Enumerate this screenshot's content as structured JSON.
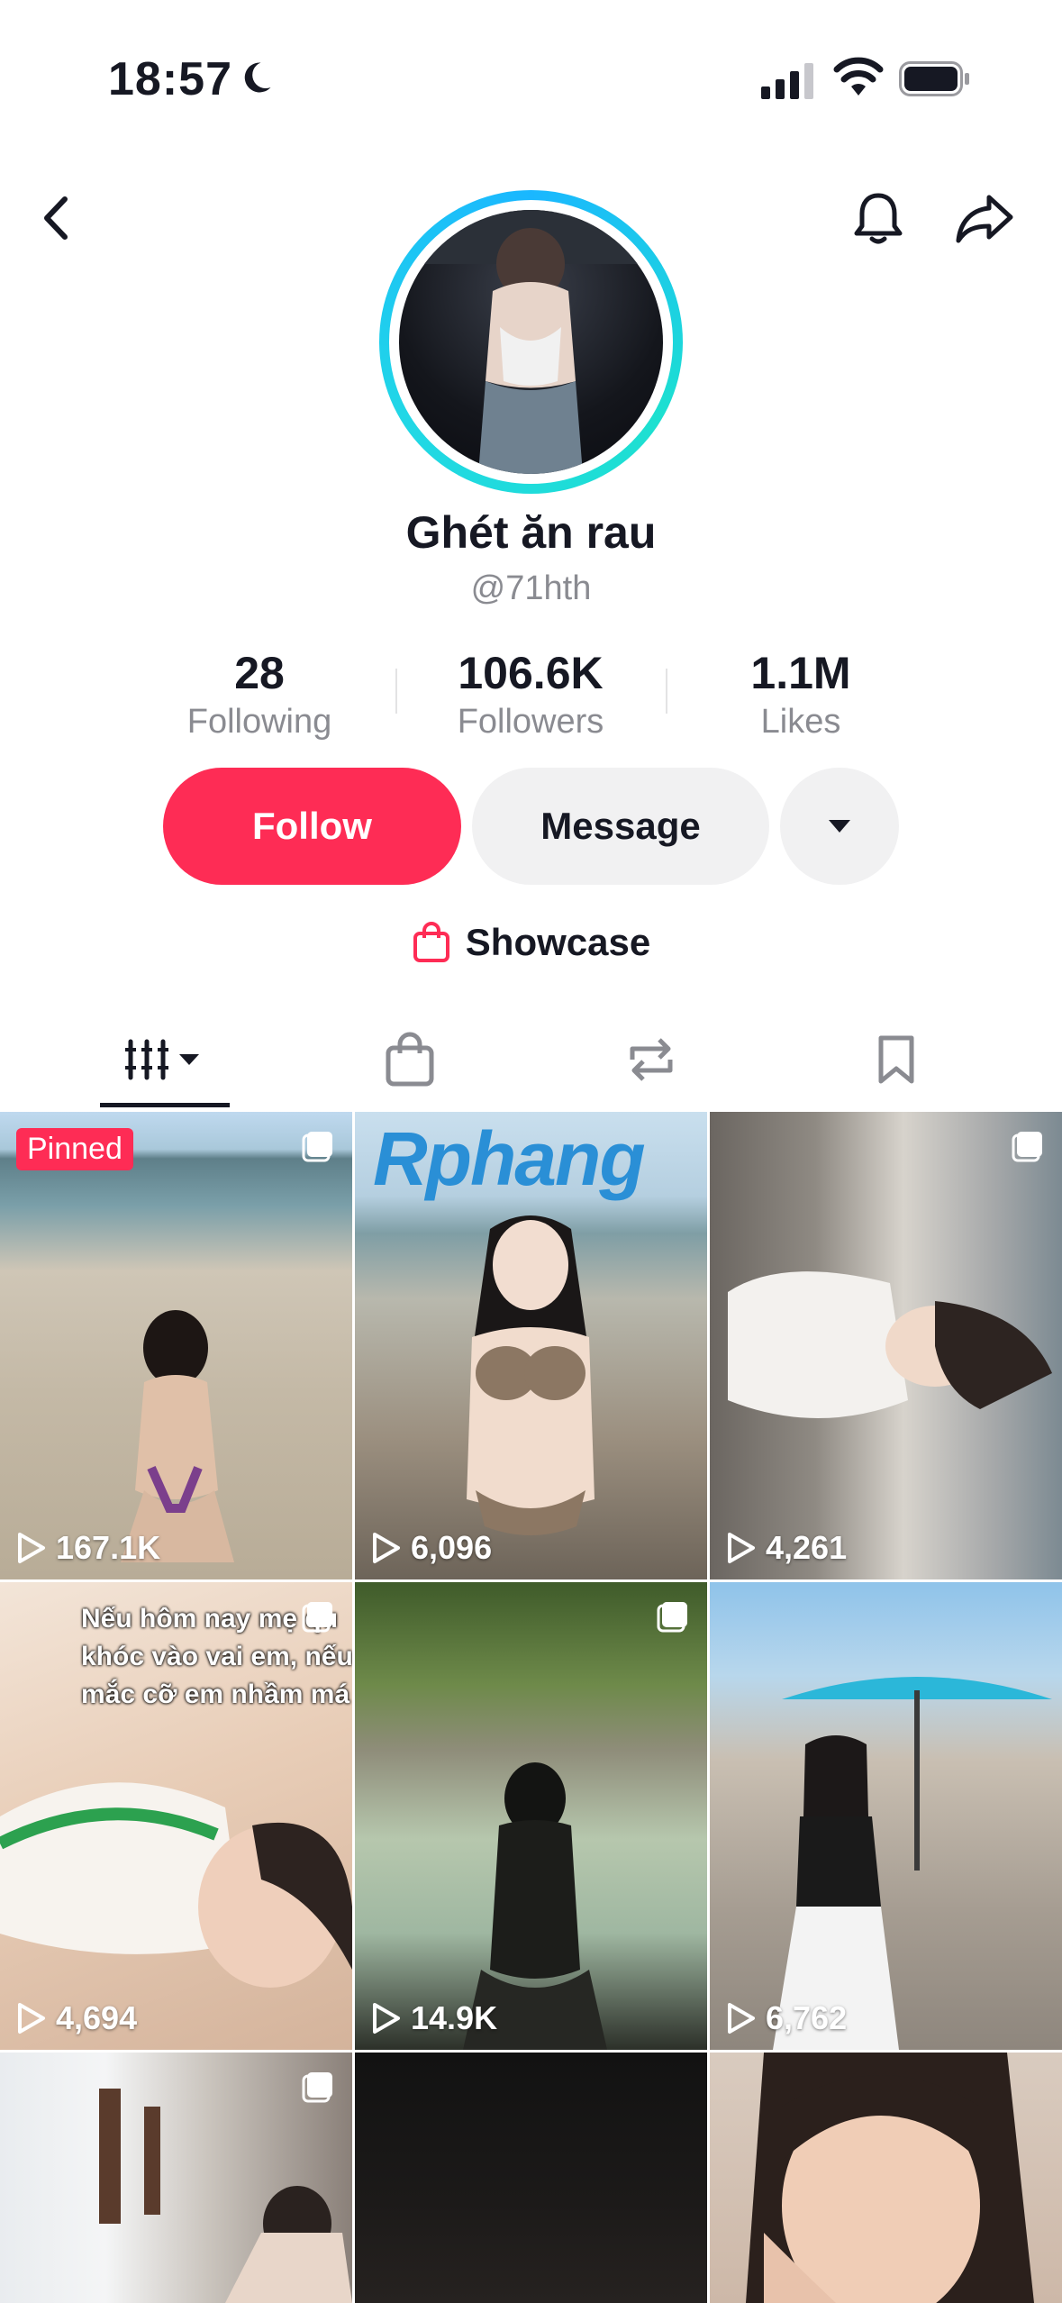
{
  "status_bar": {
    "time": "18:57"
  },
  "profile": {
    "display_name": "Ghét ăn rau",
    "username": "@71hth",
    "stats": [
      {
        "value": "28",
        "label": "Following"
      },
      {
        "value": "106.6K",
        "label": "Followers"
      },
      {
        "value": "1.1M",
        "label": "Likes"
      }
    ]
  },
  "actions": {
    "follow": "Follow",
    "message": "Message"
  },
  "showcase": {
    "label": "Showcase"
  },
  "colors": {
    "accent": "#fe2c55",
    "ring": "#1ab7ff"
  },
  "videos": [
    {
      "views": "167.1K",
      "badge": "Pinned"
    },
    {
      "views": "6,096",
      "watermark_a": "Rp",
      "watermark_b": "hang"
    },
    {
      "views": "4,261"
    },
    {
      "views": "4,694",
      "caption": [
        "Nếu hôm nay mẹ qu",
        "khóc vào vai em, nếu",
        "mắc cỡ em nhầm má"
      ]
    },
    {
      "views": "14.9K"
    },
    {
      "views": "6,762"
    }
  ]
}
